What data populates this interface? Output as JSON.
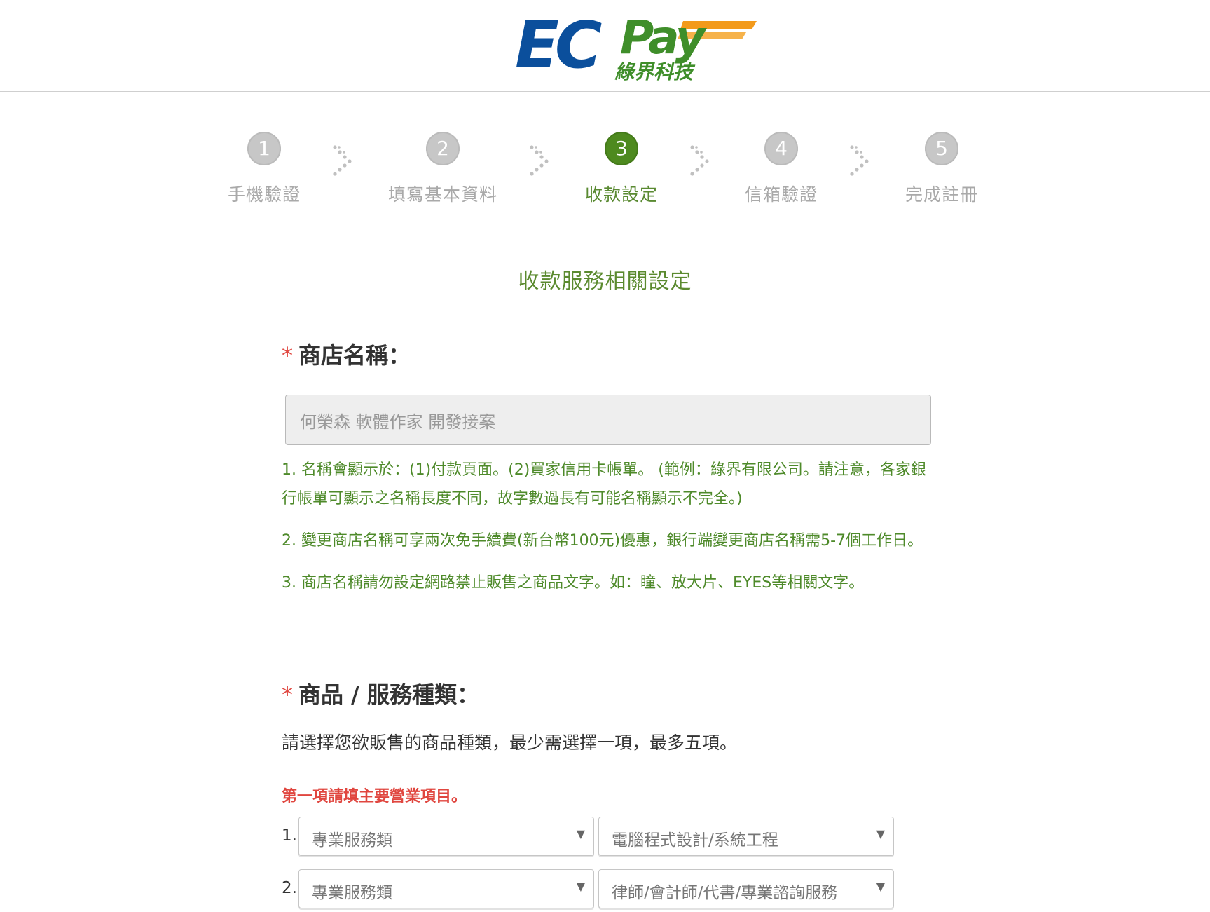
{
  "brand": {
    "logo_text": "ECPay",
    "logo_subtext": "綠界科技"
  },
  "steps": [
    {
      "number": "1",
      "label": "手機驗證",
      "active": false
    },
    {
      "number": "2",
      "label": "填寫基本資料",
      "active": false
    },
    {
      "number": "3",
      "label": "收款設定",
      "active": true
    },
    {
      "number": "4",
      "label": "信箱驗證",
      "active": false
    },
    {
      "number": "5",
      "label": "完成註冊",
      "active": false
    }
  ],
  "section_title": "收款服務相關設定",
  "store_name": {
    "required_mark": "*",
    "label": "商店名稱：",
    "value": "何榮森 軟體作家 開發接案",
    "notes": [
      "1. 名稱會顯示於：(1)付款頁面。(2)買家信用卡帳單。 (範例：綠界有限公司。請注意，各家銀行帳單可顯示之名稱長度不同，故字數過長有可能名稱顯示不完全。)",
      "2. 變更商店名稱可享兩次免手續費(新台幣100元)優惠，銀行端變更商店名稱需5-7個工作日。",
      "3. 商店名稱請勿設定網路禁止販售之商品文字。如：瞳、放大片、EYES等相關文字。"
    ]
  },
  "product_type": {
    "required_mark": "*",
    "label": "商品 / 服務種類：",
    "description": "請選擇您欲販售的商品種類，最少需選擇一項，最多五項。",
    "warning": "第一項請填主要營業項目。",
    "rows": [
      {
        "index": "1.",
        "category": "專業服務類",
        "subcategory": "電腦程式設計/系統工程"
      },
      {
        "index": "2.",
        "category": "專業服務類",
        "subcategory": "律師/會計師/代書/專業諮詢服務"
      }
    ]
  },
  "icons": {
    "dropdown": "▼",
    "step_separator": "chevron-right-dotted-icon"
  },
  "colors": {
    "brand_blue": "#0b4f9c",
    "brand_green": "#3f8e2a",
    "brand_orange": "#f39a1b",
    "active_step": "#4e8a1f",
    "notes_green": "#4e8a2a",
    "required_red": "#e0463f"
  }
}
